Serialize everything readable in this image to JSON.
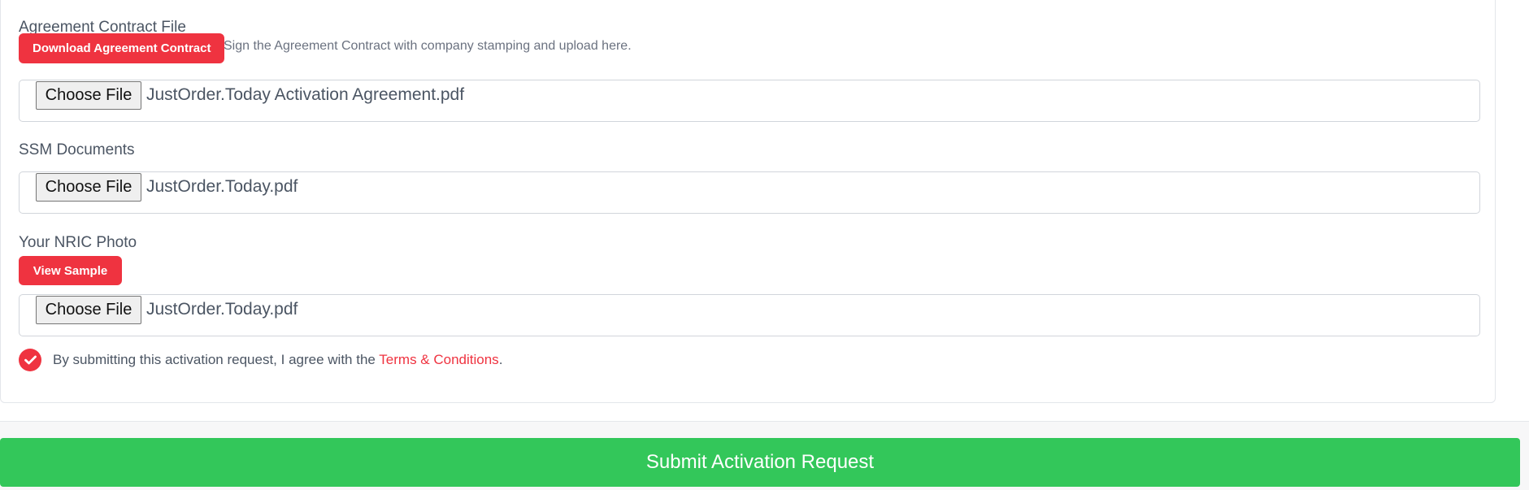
{
  "agreement": {
    "label": "Agreement Contract File",
    "download_button": "Download Agreement Contract",
    "hint": "Sign the Agreement Contract with company stamping and upload here.",
    "choose_label": "Choose File",
    "file_name": "JustOrder.Today Activation Agreement.pdf"
  },
  "ssm": {
    "label": "SSM Documents",
    "choose_label": "Choose File",
    "file_name": "JustOrder.Today.pdf"
  },
  "nric": {
    "label": "Your NRIC Photo",
    "sample_button": "View Sample",
    "choose_label": "Choose File",
    "file_name": "JustOrder.Today.pdf"
  },
  "agreement_check": {
    "checked": true,
    "text_before": "By submitting this activation request, I agree with the ",
    "link_text": "Terms & Conditions",
    "text_after": "."
  },
  "submit_label": "Submit Activation Request",
  "colors": {
    "accent_red": "#ef3340",
    "submit_green": "#33c75a"
  },
  "icons": {
    "check": "check-icon"
  }
}
